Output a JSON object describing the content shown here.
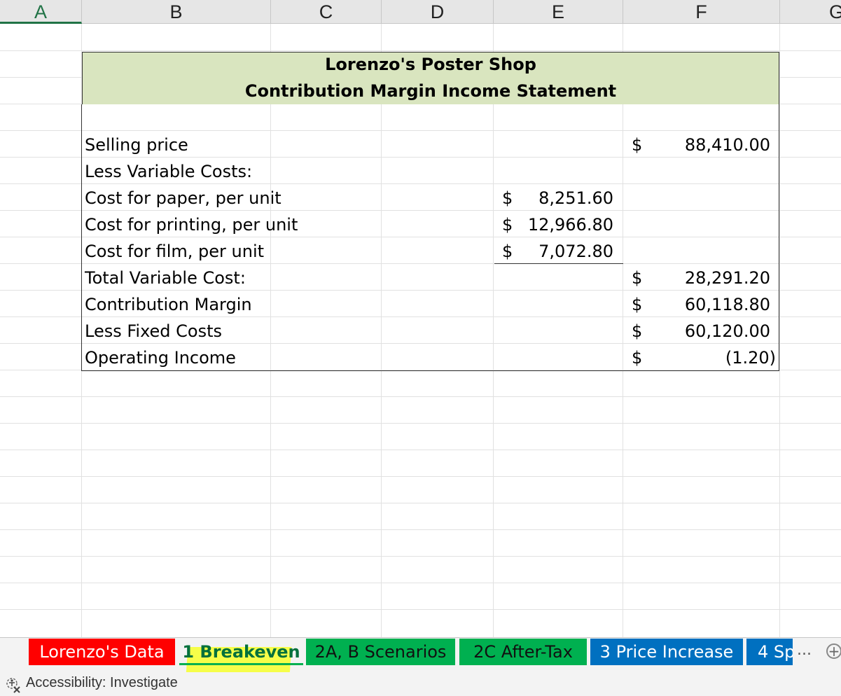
{
  "columns": [
    "A",
    "B",
    "C",
    "D",
    "E",
    "F",
    "G"
  ],
  "sheet": {
    "title_line1": "Lorenzo's Poster Shop",
    "title_line2": "Contribution Margin Income Statement",
    "rows": [
      {
        "label": "Selling price",
        "currency_f": "$",
        "value_f": "88,410.00"
      },
      {
        "label": "Less Variable Costs:"
      },
      {
        "label": "Cost for paper, per unit",
        "currency_e": "$",
        "value_e": "8,251.60"
      },
      {
        "label": "Cost for printing, per unit",
        "currency_e": "$",
        "value_e": "12,966.80"
      },
      {
        "label": "Cost for film, per unit",
        "currency_e": "$",
        "value_e": "7,072.80"
      },
      {
        "label": "Total Variable Cost:",
        "currency_f": "$",
        "value_f": "28,291.20"
      },
      {
        "label": "Contribution Margin",
        "currency_f": "$",
        "value_f": "60,118.80"
      },
      {
        "label": "Less Fixed Costs",
        "currency_f": "$",
        "value_f": "60,120.00"
      },
      {
        "label": "Operating Income",
        "currency_f": "$",
        "value_f": "(1.20)"
      }
    ]
  },
  "tabs": [
    {
      "label": "Lorenzo's Data",
      "color": "#ff0000"
    },
    {
      "label": "1 Breakeven",
      "color": "#00b050",
      "active": true
    },
    {
      "label": "2A, B Scenarios",
      "color": "#00b050"
    },
    {
      "label": "2C After-Tax",
      "color": "#00b050"
    },
    {
      "label": "3 Price Increase",
      "color": "#0070c0"
    },
    {
      "label": "4 Sp",
      "color": "#0070c0"
    }
  ],
  "more_label": "...",
  "add_sheet_icon": "plus-circle-icon",
  "status": {
    "accessibility": "Accessibility: Investigate",
    "icon": "accessibility-icon"
  }
}
